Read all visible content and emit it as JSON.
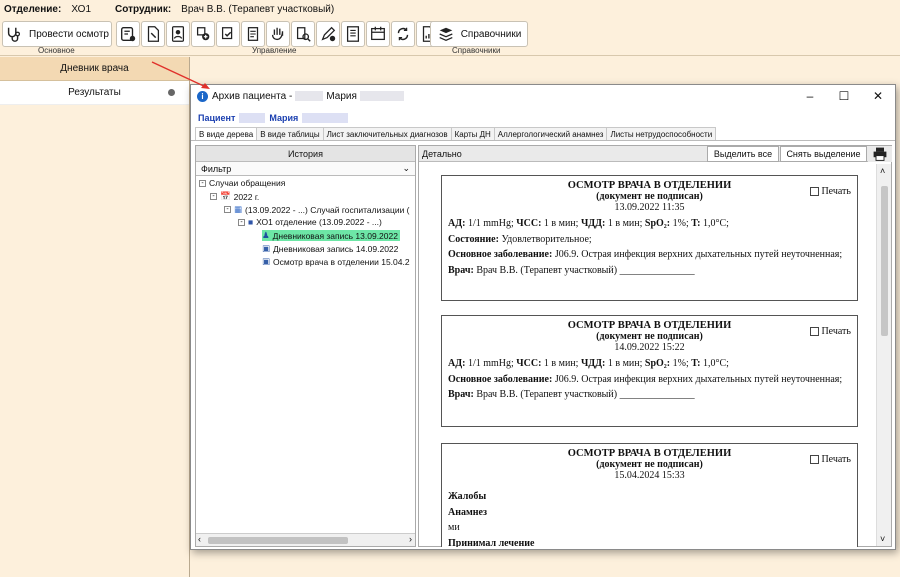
{
  "topbar": {
    "dept_label": "Отделение:",
    "dept_value": "ХО1",
    "staff_label": "Сотрудник:",
    "staff_value": "Врач В.В. (Терапевт участковый)"
  },
  "ribbon": {
    "exam_button": "Провести осмотр",
    "reference_button": "Справочники",
    "groups": {
      "main": "Основное",
      "manage": "Управление",
      "ref": "Справочники"
    }
  },
  "left_panel": {
    "header": "Дневник врача",
    "items": [
      {
        "label": "Результаты"
      }
    ]
  },
  "dialog": {
    "title_prefix": "Архив пациента -",
    "title_name": "Мария",
    "patient_label": "Пациент",
    "patient_name": "Мария",
    "tabs": [
      "В виде дерева",
      "В виде таблицы",
      "Лист заключительных диагнозов",
      "Карты ДН",
      "Аллергологический анамнез",
      "Листы нетрудоспособности"
    ],
    "left": {
      "header": "История",
      "filter": "Фильтр",
      "tree": [
        {
          "label": "Случаи обращения",
          "depth": 0
        },
        {
          "label": "2022 г.",
          "depth": 1
        },
        {
          "label": "(13.09.2022 - ...) Случай госпитализации (",
          "depth": 2
        },
        {
          "label": "ХО1 отделение (13.09.2022 - ...)",
          "depth": 3
        },
        {
          "label": "Дневниковая запись 13.09.2022",
          "depth": 4
        },
        {
          "label": "Дневниковая запись 14.09.2022",
          "depth": 4
        },
        {
          "label": "Осмотр врача в отделении 15.04.2",
          "depth": 4
        }
      ]
    },
    "right": {
      "header": "Детально",
      "select_all": "Выделить все",
      "deselect": "Снять выделение",
      "print_label": "Печать",
      "cards": [
        {
          "title": "ОСМОТР ВРАЧА В ОТДЕЛЕНИИ",
          "subtitle": "(документ не подписан)",
          "datetime": "13.09.2022 11:35",
          "vitals": {
            "ad_label": "АД:",
            "ad_value": "1/1 mmHg;",
            "hr_label": "ЧСС:",
            "hr_value": "1 в мин;",
            "rr_label": "ЧДД:",
            "rr_value": "1 в мин;",
            "spo2_label": "SpO₂:",
            "spo2_value": "1%;",
            "t_label": "T:",
            "t_value": "1,0°C;"
          },
          "state_label": "Состояние:",
          "state_value": "Удовлетворительное;",
          "diag_label": "Основное заболевание:",
          "diag_value": "J06.9. Острая инфекция верхних дыхательных путей неуточненная;",
          "doctor_label": "Врач:",
          "doctor_value": "Врач В.В. (Терапевт участковый) _______________"
        },
        {
          "title": "ОСМОТР ВРАЧА В ОТДЕЛЕНИИ",
          "subtitle": "(документ не подписан)",
          "datetime": "14.09.2022 15:22",
          "vitals": {
            "ad_label": "АД:",
            "ad_value": "1/1 mmHg;",
            "hr_label": "ЧСС:",
            "hr_value": "1 в мин;",
            "rr_label": "ЧДД:",
            "rr_value": "1 в мин;",
            "spo2_label": "SpO₂:",
            "spo2_value": "1%;",
            "t_label": "T:",
            "t_value": "1,0°C;"
          },
          "diag_label": "Основное заболевание:",
          "diag_value": "J06.9. Острая инфекция верхних дыхательных путей неуточненная;",
          "doctor_label": "Врач:",
          "doctor_value": "Врач В.В. (Терапевт участковый) _______________"
        },
        {
          "title": "ОСМОТР ВРАЧА В ОТДЕЛЕНИИ",
          "subtitle": "(документ не подписан)",
          "datetime": "15.04.2024 15:33",
          "complaints_label": "Жалобы",
          "anamnesis_label": "Анамнез",
          "anamnesis_value": "ми",
          "treatment_label": "Принимал лечение"
        }
      ]
    }
  }
}
